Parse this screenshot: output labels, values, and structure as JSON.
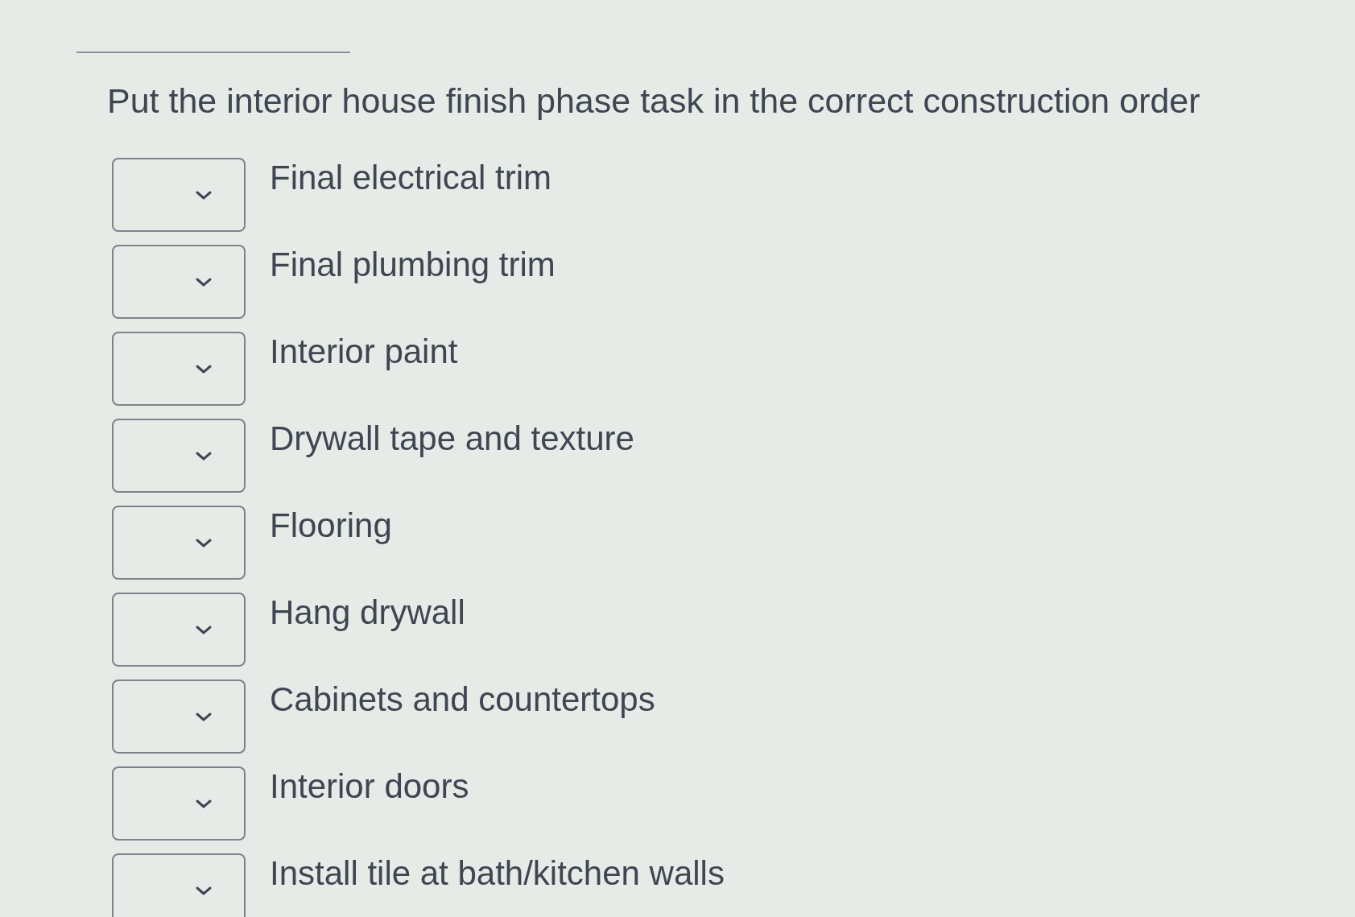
{
  "question": "Put the interior house finish phase task in the correct construction order",
  "items": [
    {
      "label": "Final electrical trim"
    },
    {
      "label": "Final plumbing trim"
    },
    {
      "label": "Interior paint"
    },
    {
      "label": "Drywall tape and texture"
    },
    {
      "label": "Flooring"
    },
    {
      "label": "Hang drywall"
    },
    {
      "label": "Cabinets and countertops"
    },
    {
      "label": "Interior doors"
    },
    {
      "label": "Install tile at bath/kitchen walls"
    }
  ]
}
